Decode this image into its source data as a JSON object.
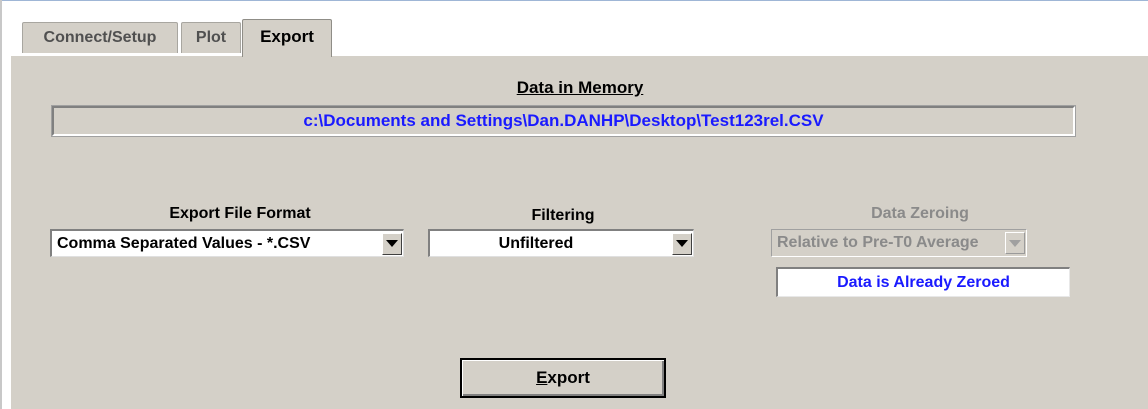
{
  "tabs": {
    "connect_setup": "Connect/Setup",
    "plot": "Plot",
    "export": "Export",
    "active": "Export"
  },
  "data_in_memory": {
    "title": "Data in Memory",
    "path": "c:\\Documents and Settings\\Dan.DANHP\\Desktop\\Test123rel.CSV"
  },
  "export_format": {
    "label": "Export File Format",
    "value": "Comma Separated Values - *.CSV"
  },
  "filtering": {
    "label": "Filtering",
    "value": "Unfiltered"
  },
  "data_zeroing": {
    "label": "Data Zeroing",
    "value": "Relative to Pre-T0 Average",
    "enabled": false,
    "status": "Data is Already Zeroed"
  },
  "export_button": {
    "label_first": "E",
    "label_rest": "xport"
  },
  "colors": {
    "panel_bg": "#d4d0c8",
    "path_text": "#1a1aff",
    "status_text": "#1a1aff",
    "disabled_text": "#8a8a8a"
  },
  "icons": {
    "dropdown_arrow": "chevron-down-icon"
  }
}
